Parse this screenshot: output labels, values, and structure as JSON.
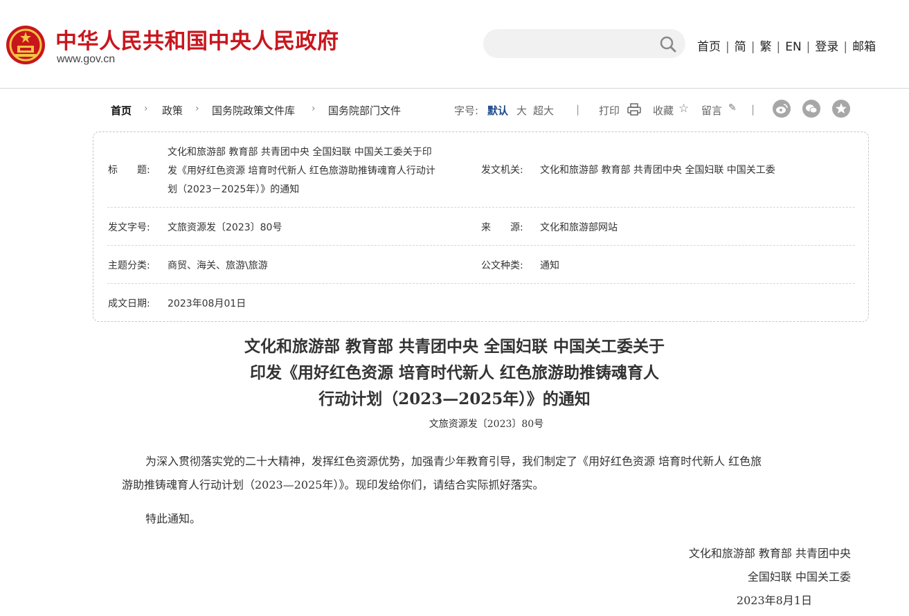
{
  "header": {
    "site_name": "中华人民共和国中央人民政府",
    "site_url": "www.gov.cn",
    "search": {
      "placeholder": "",
      "value": ""
    },
    "links": [
      "首页",
      "简",
      "繁",
      "EN",
      "登录",
      "邮箱"
    ]
  },
  "breadcrumb": [
    "首页",
    "政策",
    "国务院政策文件库",
    "国务院部门文件"
  ],
  "tools": {
    "font_label": "字号:",
    "font_default": "默认",
    "font_large": "大",
    "font_xlarge": "超大",
    "print": "打印",
    "favorite": "收藏",
    "comment": "留言"
  },
  "info": {
    "title_label": "标　　题:",
    "title_lines": [
      "文化和旅游部 教育部 共青团中央 全国妇联 中国关工委关于印",
      "发《用好红色资源 培育时代新人 红色旅游助推铸魂育人行动计",
      "划（2023－2025年）》的通知"
    ],
    "issuer_label": "发文机关:",
    "issuer": "文化和旅游部 教育部 共青团中央 全国妇联 中国关工委",
    "docno_label": "发文字号:",
    "docno": "文旅资源发〔2023〕80号",
    "source_label": "来　　源:",
    "source": "文化和旅游部网站",
    "topic_label": "主题分类:",
    "topic": "商贸、海关、旅游\\旅游",
    "type_label": "公文种类:",
    "type": "通知",
    "date_label": "成文日期:",
    "date": "2023年08月01日"
  },
  "article": {
    "title_lines": [
      "文化和旅游部 教育部 共青团中央 全国妇联 中国关工委关于",
      "印发《用好红色资源 培育时代新人 红色旅游助推铸魂育人",
      "行动计划（2023—2025年）》的通知"
    ],
    "doc_number": "文旅资源发〔2023〕80号",
    "para_line1": "为深入贯彻落实党的二十大精神，发挥红色资源优势，加强青少年教育引导，我们制定了《用好红色资源 培育时代新人 红色旅",
    "para_line2": "游助推铸魂育人行动计划（2023—2025年）》。现印发给你们，请结合实际抓好落实。",
    "notice": "特此通知。",
    "signature_line1": "文化和旅游部 教育部 共青团中央",
    "signature_line2": "全国妇联 中国关工委",
    "signature_date": "2023年8月1日"
  },
  "colors": {
    "brand_red": "#c8161d",
    "accent_blue": "#1e4a8c",
    "icon_gray": "#a7a7a7"
  }
}
